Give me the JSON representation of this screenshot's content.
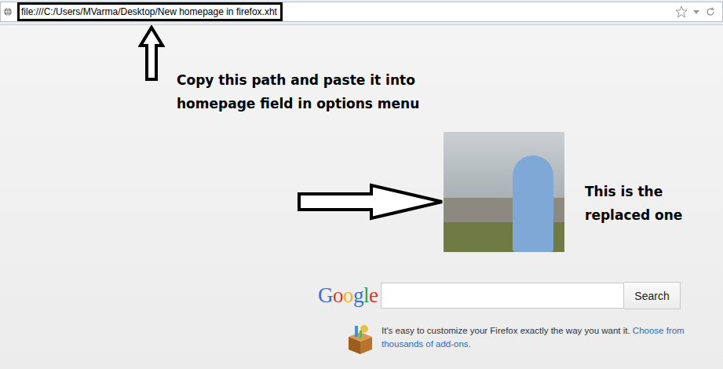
{
  "address_bar": {
    "url": "file:///C:/Users/MVarma/Desktop/New homepage in firefox.xht",
    "highlighted": true
  },
  "annotations": [
    {
      "text": "Copy this path and paste it into homepage field in options menu",
      "kind": "up"
    },
    {
      "text": "This is the replaced one",
      "kind": "right"
    }
  ],
  "search": {
    "logo": "Google",
    "value": "",
    "button": "Search"
  },
  "promo": {
    "text": "It's easy to customize your Firefox exactly the way you want it.",
    "link": "Choose from thousands of add-ons."
  }
}
